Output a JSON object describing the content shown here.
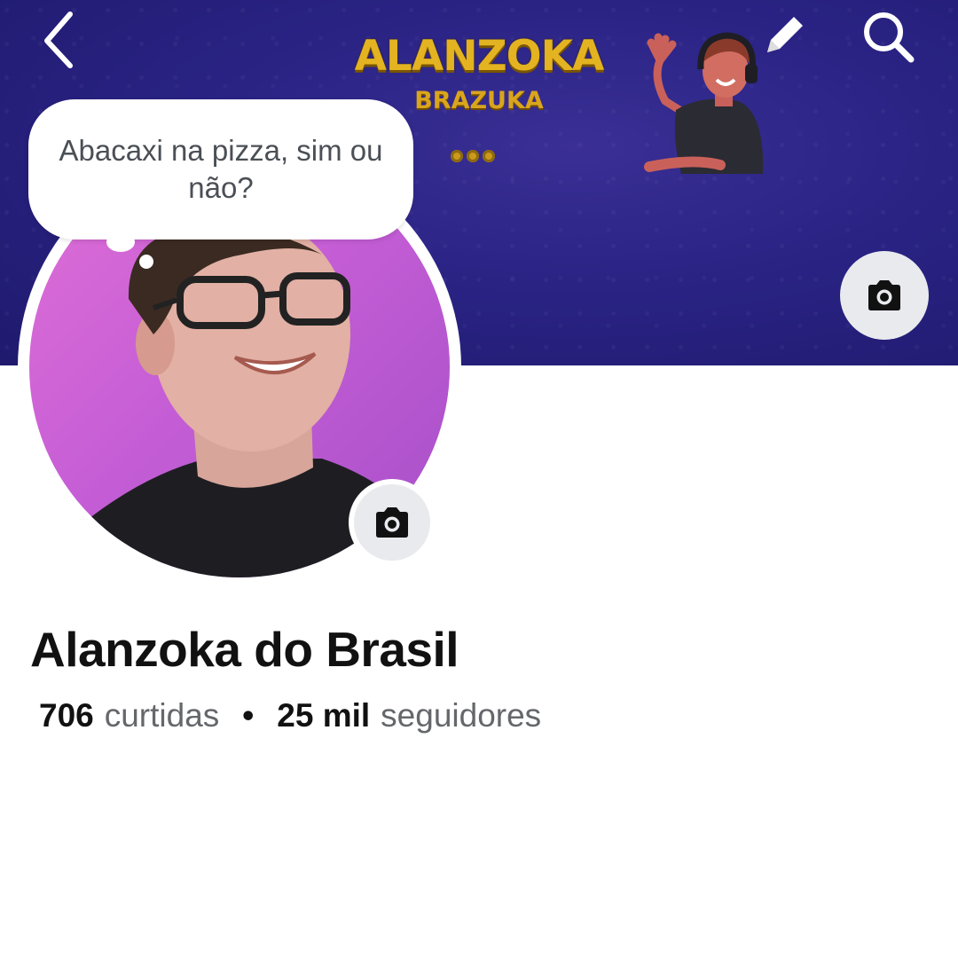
{
  "cover": {
    "title": "ALANZOKA",
    "subtitle": "BRAZUKA",
    "colors": {
      "background": "#2a2384",
      "title": "#e3b321"
    }
  },
  "nav": {
    "back_icon": "chevron-left-icon",
    "edit_icon": "pencil-icon",
    "search_icon": "search-icon"
  },
  "profile": {
    "note": "Abacaxi na pizza, sim ou não?",
    "name": "Alanzoka do Brasil",
    "likes_count": "706",
    "likes_label": "curtidas",
    "separator": "•",
    "followers_count": "25 mil",
    "followers_label": "seguidores",
    "camera_icon": "camera-icon"
  }
}
